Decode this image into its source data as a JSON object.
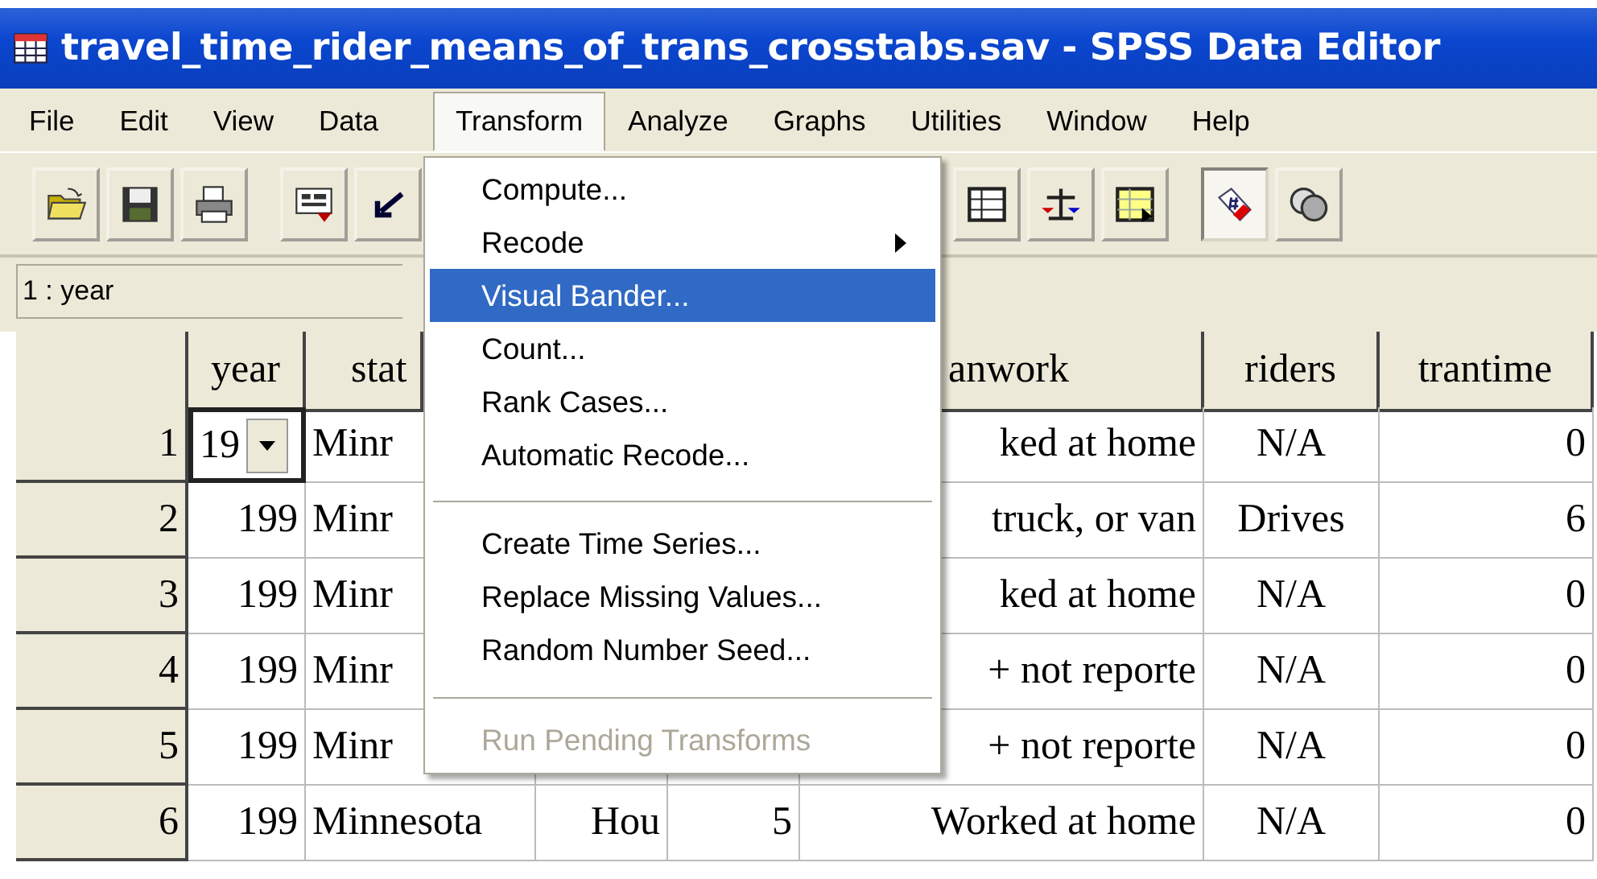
{
  "window": {
    "title": "travel_time_rider_means_of_trans_crosstabs.sav - SPSS Data Editor"
  },
  "menu_bar": [
    {
      "label": "File",
      "selected": false
    },
    {
      "label": "Edit",
      "selected": false
    },
    {
      "label": "View",
      "selected": false
    },
    {
      "label": "Data",
      "selected": false
    },
    {
      "label": "Transform",
      "selected": true
    },
    {
      "label": "Analyze",
      "selected": false
    },
    {
      "label": "Graphs",
      "selected": false
    },
    {
      "label": "Utilities",
      "selected": false
    },
    {
      "label": "Window",
      "selected": false
    },
    {
      "label": "Help",
      "selected": false
    }
  ],
  "toolbar": {
    "left": [
      {
        "kind": "open",
        "pressed": false
      },
      {
        "kind": "save",
        "pressed": false
      },
      {
        "kind": "print",
        "pressed": false
      },
      {
        "kind": "dialog",
        "pressed": false
      },
      {
        "kind": "undo",
        "pressed": false
      }
    ],
    "right": [
      {
        "kind": "grid",
        "pressed": false
      },
      {
        "kind": "weight",
        "pressed": false
      },
      {
        "kind": "select",
        "pressed": false
      },
      {
        "kind": "labels",
        "pressed": true
      },
      {
        "kind": "sets",
        "pressed": false
      }
    ]
  },
  "cell_reference": "1 : year",
  "table": {
    "columns": [
      "year",
      "stat",
      null,
      null,
      "anwork",
      "riders",
      "trantime"
    ],
    "rows": [
      {
        "number": "1",
        "editing": true,
        "cells": [
          "19",
          "Minr",
          null,
          null,
          "ked at home",
          "N/A",
          "0"
        ]
      },
      {
        "number": "2",
        "editing": false,
        "cells": [
          "199",
          "Minr",
          null,
          null,
          "truck, or van",
          "Drives",
          "6"
        ]
      },
      {
        "number": "3",
        "editing": false,
        "cells": [
          "199",
          "Minr",
          null,
          null,
          "ked at home",
          "N/A",
          "0"
        ]
      },
      {
        "number": "4",
        "editing": false,
        "cells": [
          "199",
          "Minr",
          null,
          null,
          "+ not reporte",
          "N/A",
          "0"
        ]
      },
      {
        "number": "5",
        "editing": false,
        "cells": [
          "199",
          "Minr",
          null,
          null,
          "+ not reporte",
          "N/A",
          "0"
        ]
      },
      {
        "number": "6",
        "editing": false,
        "cells": [
          "199",
          "Minnesota",
          "Hou",
          "5",
          "Worked at home",
          "N/A",
          "0"
        ]
      }
    ]
  },
  "transform_menu": [
    {
      "kind": "item",
      "label": "Compute...",
      "selected": false,
      "disabled": false,
      "submenu": false
    },
    {
      "kind": "item",
      "label": "Recode",
      "selected": false,
      "disabled": false,
      "submenu": true
    },
    {
      "kind": "item",
      "label": "Visual Bander...",
      "selected": true,
      "disabled": false,
      "submenu": false
    },
    {
      "kind": "item",
      "label": "Count...",
      "selected": false,
      "disabled": false,
      "submenu": false
    },
    {
      "kind": "item",
      "label": "Rank Cases...",
      "selected": false,
      "disabled": false,
      "submenu": false
    },
    {
      "kind": "item",
      "label": "Automatic Recode...",
      "selected": false,
      "disabled": false,
      "submenu": false
    },
    {
      "kind": "separator"
    },
    {
      "kind": "item",
      "label": "Create Time Series...",
      "selected": false,
      "disabled": false,
      "submenu": false
    },
    {
      "kind": "item",
      "label": "Replace Missing Values...",
      "selected": false,
      "disabled": false,
      "submenu": false
    },
    {
      "kind": "item",
      "label": "Random Number Seed...",
      "selected": false,
      "disabled": false,
      "submenu": false
    },
    {
      "kind": "separator"
    },
    {
      "kind": "item",
      "label": "Run Pending Transforms",
      "selected": false,
      "disabled": true,
      "submenu": false
    }
  ]
}
